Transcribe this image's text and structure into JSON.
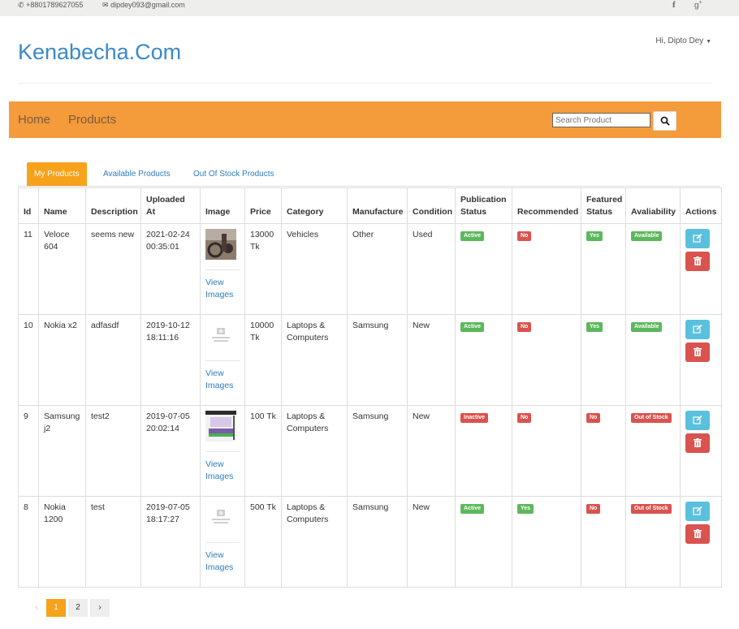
{
  "topbar": {
    "phone": "+8801789627055",
    "email": "dipdey093@gmail.com"
  },
  "brand": "Kenabecha.Com",
  "user_menu": "Hi, Dipto Dey",
  "nav": {
    "home": "Home",
    "products": "Products",
    "search_placeholder": "Search Product"
  },
  "tabs": [
    "My Products",
    "Available Products",
    "Out Of Stock Products"
  ],
  "columns": [
    "Id",
    "Name",
    "Description",
    "Uploaded At",
    "Image",
    "Price",
    "Category",
    "Manufacture",
    "Condition",
    "Publication Status",
    "Recommended",
    "Featured Status",
    "Avaliability",
    "Actions"
  ],
  "rows": [
    {
      "id": "11",
      "name": "Veloce 604",
      "description": "seems new",
      "uploaded": "2021-02-24 00:35:01",
      "image": "photo",
      "view": "View Images",
      "price": "13000 Tk",
      "category": "Vehicles",
      "manufacture": "Other",
      "condition": "Used",
      "publication": "Active",
      "recommended": "No",
      "featured": "Yes",
      "availability": "Available"
    },
    {
      "id": "10",
      "name": "Nokia x2",
      "description": "adfasdf",
      "uploaded": "2019-10-12 18:11:16",
      "image": "none",
      "view": "View Images",
      "price": "10000 Tk",
      "category": "Laptops & Computers",
      "manufacture": "Samsung",
      "condition": "New",
      "publication": "Active",
      "recommended": "No",
      "featured": "Yes",
      "availability": "Available"
    },
    {
      "id": "9",
      "name": "Samsung j2",
      "description": "test2",
      "uploaded": "2019-07-05 20:02:14",
      "image": "screen",
      "view": "View Images",
      "price": "100 Tk",
      "category": "Laptops & Computers",
      "manufacture": "Samsung",
      "condition": "New",
      "publication": "Inactive",
      "recommended": "No",
      "featured": "No",
      "availability": "Out of Stock"
    },
    {
      "id": "8",
      "name": "Nokia 1200",
      "description": "test",
      "uploaded": "2019-07-05 18:17:27",
      "image": "none",
      "view": "View Images",
      "price": "500 Tk",
      "category": "Laptops & Computers",
      "manufacture": "Samsung",
      "condition": "New",
      "publication": "Active",
      "recommended": "Yes",
      "featured": "No",
      "availability": "Out of Stock"
    }
  ],
  "pagination": {
    "prev": "‹",
    "pages": [
      "1",
      "2"
    ],
    "next": "›",
    "current": "1"
  },
  "colors": {
    "brand": "#3a89c9",
    "navbar": "#f49b3c",
    "active_tab": "#f7a21b",
    "success": "#5cb85c",
    "danger": "#d9534f",
    "info": "#5bc0de"
  }
}
